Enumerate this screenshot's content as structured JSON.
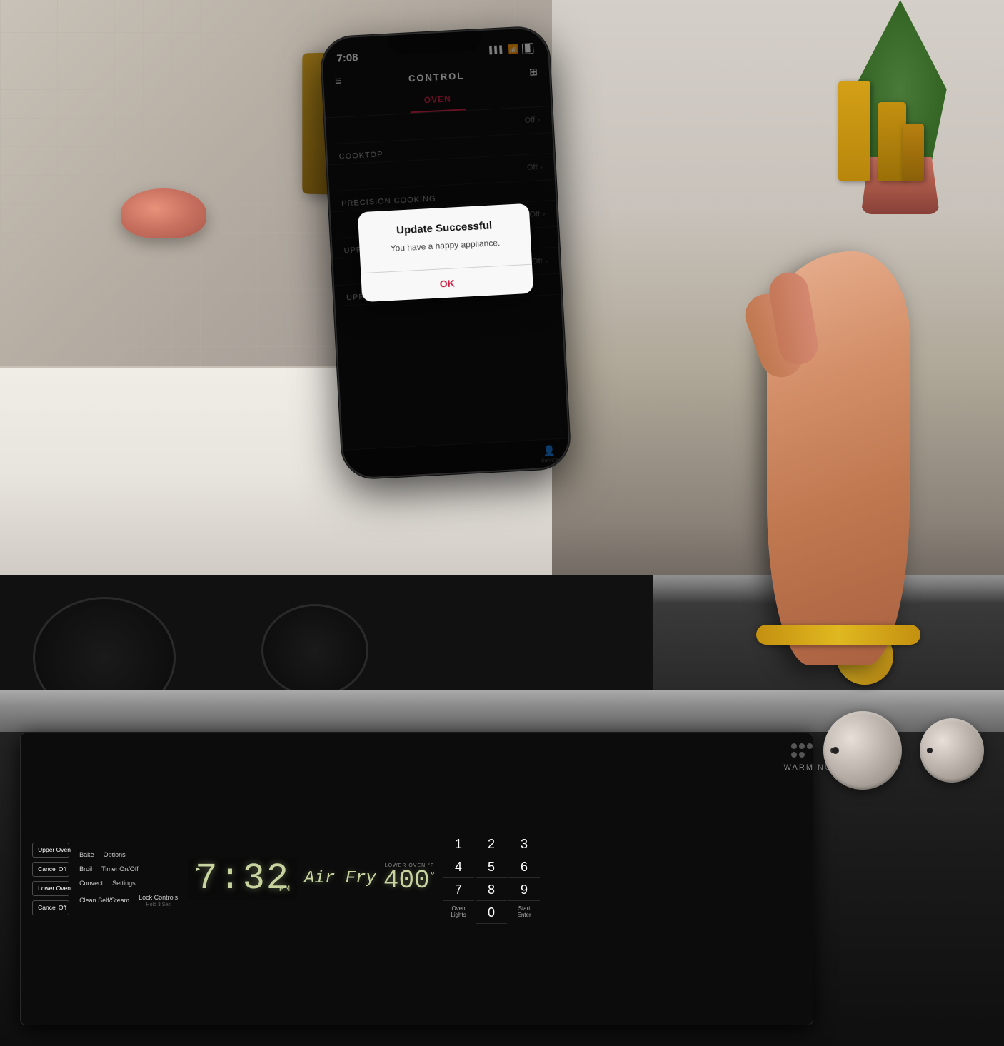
{
  "kitchen": {
    "background_color": "#b8a898"
  },
  "phone": {
    "status_bar": {
      "time": "7:08",
      "signal": "●●●",
      "wifi": "wifi",
      "battery": "battery"
    },
    "header": {
      "title": "CONTROL",
      "menu_icon": "≡",
      "grid_icon": "⊞"
    },
    "tabs": [
      {
        "label": "OVEN",
        "active": true
      }
    ],
    "rows": [
      {
        "label": "",
        "value": "Off",
        "hasChevron": false
      },
      {
        "label": "COOKTOP",
        "value": "",
        "hasChevron": false
      },
      {
        "label": "",
        "value": "Off",
        "hasChevron": true
      },
      {
        "label": "PRECISION COOKING",
        "value": "",
        "hasChevron": false
      },
      {
        "label": "",
        "value": "Off",
        "hasChevron": true
      },
      {
        "label": "UPPER OVEN",
        "value": "",
        "hasChevron": false
      },
      {
        "label": "",
        "value": "Off",
        "hasChevron": true
      },
      {
        "label": "UPPER OVEN KITCHEN TIMER",
        "value": "",
        "hasChevron": false
      }
    ],
    "dialog": {
      "title": "Update Successful",
      "message": "You have a happy appliance.",
      "button": "OK"
    }
  },
  "control_panel": {
    "buttons": {
      "upper_oven": "Upper\nOven",
      "cancel_off_upper": "Cancel\nOff",
      "lower_oven": "Lower\nOven",
      "cancel_off_lower": "Cancel\nOff",
      "bake": "Bake",
      "broil": "Broil",
      "convect": "Convect",
      "clean": "Clean\nSelf/Steam",
      "options": "Options",
      "timer": "Timer\nOn/Off",
      "settings": "Settings",
      "lock_controls": "Lock\nControls",
      "hold_3_sec": "Hold 3 Sec"
    },
    "display": {
      "time": "7:32",
      "pm_label": "PM",
      "dot_label": "▸",
      "air_fry": "Air Fry",
      "lower_oven_label": "LOWER OVEN °F",
      "lower_oven_temp": "400"
    },
    "numpad": {
      "keys": [
        "1",
        "2",
        "3",
        "4",
        "5",
        "6",
        "7",
        "8",
        "9",
        "",
        "0",
        ""
      ],
      "labels": {
        "oven_lights": "Oven\nLights",
        "start_enter": "Start\nEnter"
      }
    },
    "warming_zone": "WARMING ZONE"
  }
}
